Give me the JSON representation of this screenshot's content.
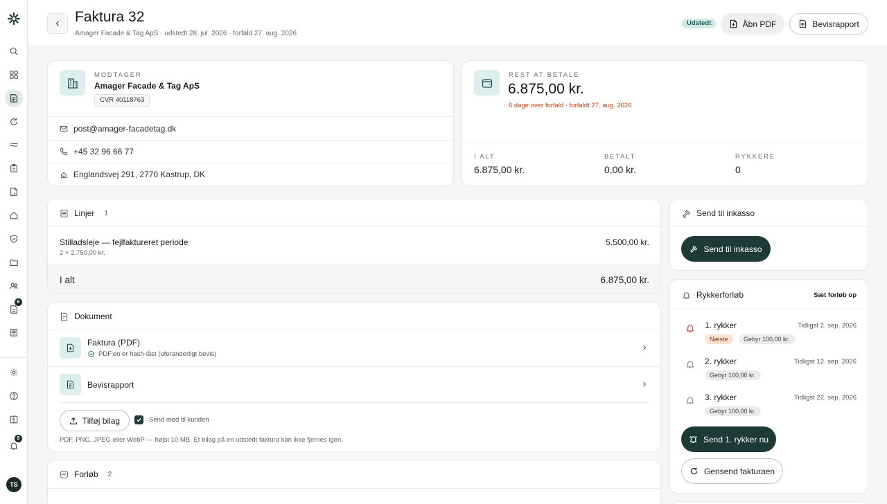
{
  "sidebar": {
    "items": [
      {
        "icon": "search-icon",
        "name": "sidebar-item-search"
      },
      {
        "icon": "grid-icon",
        "name": "sidebar-item-overview"
      },
      {
        "icon": "invoice-icon",
        "name": "sidebar-item-invoices"
      },
      {
        "icon": "refresh-icon",
        "name": "sidebar-item-subscriptions"
      },
      {
        "icon": "transfer-icon",
        "name": "sidebar-item-payments"
      },
      {
        "icon": "clipboard-icon",
        "name": "sidebar-item-tasks"
      },
      {
        "icon": "document-icon",
        "name": "sidebar-item-documents"
      },
      {
        "icon": "home-icon",
        "name": "sidebar-item-properties"
      },
      {
        "icon": "shield-icon",
        "name": "sidebar-item-security"
      },
      {
        "icon": "folder-icon",
        "name": "sidebar-item-files"
      },
      {
        "icon": "users-icon",
        "name": "sidebar-item-customers"
      },
      {
        "icon": "inbox-icon",
        "name": "sidebar-item-inbox",
        "badge": "6"
      },
      {
        "icon": "archive-icon",
        "name": "sidebar-item-archive"
      }
    ],
    "bottom": [
      {
        "icon": "gear-icon",
        "name": "sidebar-item-settings"
      },
      {
        "icon": "help-icon",
        "name": "sidebar-item-help"
      },
      {
        "icon": "book-icon",
        "name": "sidebar-item-guide"
      },
      {
        "icon": "bell-icon",
        "name": "sidebar-item-notifications",
        "badge": "9"
      }
    ],
    "avatar": "TS"
  },
  "header": {
    "title": "Faktura 32",
    "subtitle": "Amager Facade & Tag ApS · udstedt 28. jul. 2026 · forfald 27. aug. 2026",
    "status": "Udstedt",
    "open_pdf": "Åbn PDF",
    "report": "Bevisrapport"
  },
  "recipient": {
    "label": "MODTAGER",
    "name": "Amager Facade & Tag ApS",
    "cvr": "CVR 40118763",
    "email": "post@amager-facadetag.dk",
    "phone": "+45 32 96 66 77",
    "address": "Englandsvej 291, 2770 Kastrup, DK"
  },
  "balance": {
    "label": "REST AT BETALE",
    "amount": "6.875,00 kr.",
    "warning": "6 dage over forfald · forfaldt 27. aug. 2026",
    "stats": [
      {
        "label": "I ALT",
        "value": "6.875,00 kr."
      },
      {
        "label": "BETALT",
        "value": "0,00 kr."
      },
      {
        "label": "RYKKERE",
        "value": "0"
      }
    ]
  },
  "lines": {
    "title": "Linjer",
    "count": "1",
    "items": [
      {
        "description": "Stilladsleje — fejlfaktureret periode",
        "qty": "2 × 2.750,00 kr.",
        "amount": "5.500,00 kr."
      }
    ],
    "total_label": "I alt",
    "total_amount": "6.875,00 kr."
  },
  "document": {
    "title": "Dokument",
    "pdf_title": "Faktura (PDF)",
    "pdf_hash": "PDF'en er hash-låst (uforanderligt bevis)",
    "report_title": "Bevisrapport",
    "add_attachment": "Tilføj bilag",
    "send_with": "Send med til kunden",
    "hint": "PDF, PNG, JPEG eller WebP — højst 10 MB. Et bilag på en udstedt faktura kan ikke fjernes igen."
  },
  "timeline": {
    "title": "Forløb",
    "count": "2"
  },
  "inkasso": {
    "title": "Send til inkasso",
    "button": "Send til inkasso"
  },
  "reminders": {
    "title": "Rykkerforløb",
    "setup": "Sæt forløb op",
    "items": [
      {
        "title": "1. rykker",
        "date": "Tidligst 2. sep. 2026",
        "next": "Næste",
        "fee": "Gebyr 100,00 kr."
      },
      {
        "title": "2. rykker",
        "date": "Tidligst 12. sep. 2026",
        "fee": "Gebyr 100,00 kr."
      },
      {
        "title": "3. rykker",
        "date": "Tidligst 22. sep. 2026",
        "fee": "Gebyr 100,00 kr."
      }
    ],
    "send_now": "Send 1. rykker nu",
    "resend": "Gensend fakturaen"
  }
}
